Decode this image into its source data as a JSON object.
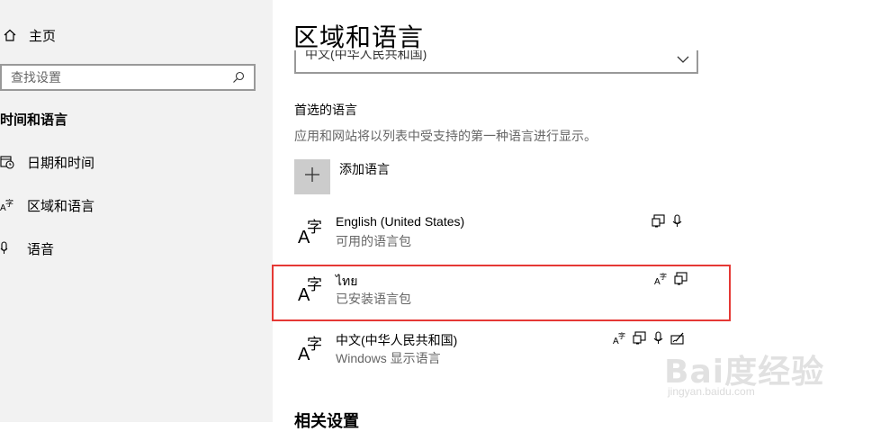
{
  "sidebar": {
    "home_label": "主页",
    "search_placeholder": "查找设置",
    "section_heading": "时间和语言",
    "items": [
      {
        "label": "日期和时间",
        "icon": "calendar-clock-icon"
      },
      {
        "label": "区域和语言",
        "icon": "language-icon"
      },
      {
        "label": "语音",
        "icon": "microphone-icon"
      }
    ]
  },
  "main": {
    "title": "区域和语言",
    "country_dropdown_value": "中文(中华人民共和国)",
    "preferred_heading": "首选的语言",
    "preferred_description": "应用和网站将以列表中受支持的第一种语言进行显示。",
    "add_language_label": "添加语言",
    "languages": [
      {
        "name": "English (United States)",
        "status": "可用的语言包",
        "features": [
          "display-icon",
          "microphone-icon"
        ]
      },
      {
        "name": "ไทย",
        "status": "已安装语言包",
        "features": [
          "language-icon",
          "display-icon"
        ]
      },
      {
        "name": "中文(中华人民共和国)",
        "status": "Windows 显示语言",
        "features": [
          "language-icon",
          "display-icon",
          "microphone-icon",
          "handwriting-icon"
        ]
      }
    ],
    "related_heading": "相关设置"
  },
  "watermark": {
    "text": "Bai度经验",
    "sub": "jingyan.baidu.com"
  },
  "colors": {
    "sidebar_bg": "#f2f2f2",
    "highlight_border": "#e53935",
    "add_button_bg": "#cccccc",
    "secondary_text": "#666666"
  }
}
